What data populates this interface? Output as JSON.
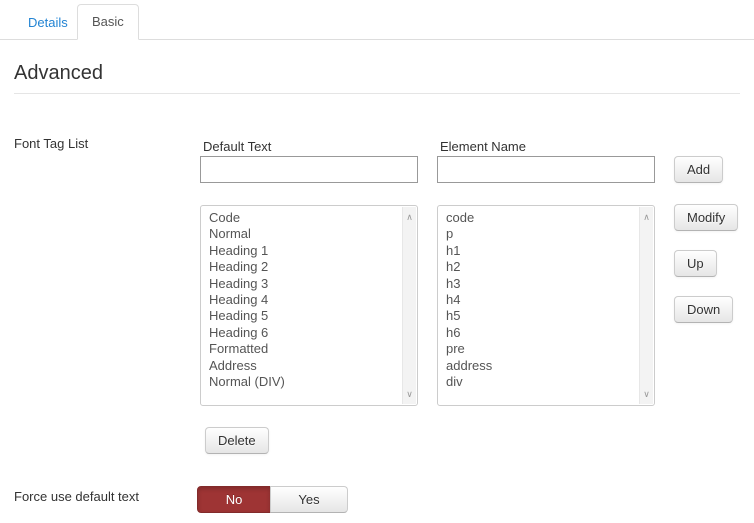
{
  "tabs": {
    "details": {
      "label": "Details",
      "active": false
    },
    "basic": {
      "label": "Basic",
      "active": true
    }
  },
  "heading": "Advanced",
  "form": {
    "font_tag_list": {
      "label": "Font Tag List",
      "default_text": {
        "label": "Default Text",
        "value": "",
        "placeholder": ""
      },
      "element_name": {
        "label": "Element Name",
        "value": "",
        "placeholder": ""
      },
      "default_text_options": [
        "Code",
        "Normal",
        "Heading 1",
        "Heading 2",
        "Heading 3",
        "Heading 4",
        "Heading 5",
        "Heading 6",
        "Formatted",
        "Address",
        "Normal (DIV)"
      ],
      "element_name_options": [
        "code",
        "p",
        "h1",
        "h2",
        "h3",
        "h4",
        "h5",
        "h6",
        "pre",
        "address",
        "div"
      ],
      "buttons": {
        "add": "Add",
        "modify": "Modify",
        "up": "Up",
        "down": "Down",
        "delete": "Delete"
      }
    },
    "force_use_default_text": {
      "label": "Force use default text",
      "selected": "No",
      "options": {
        "no": "No",
        "yes": "Yes"
      }
    }
  },
  "icons": {
    "scroll_up": "∧",
    "scroll_down": "∨"
  },
  "colors": {
    "tab_link_blue": "#2384d3",
    "tab_border": "#dddddd",
    "legend_border": "#e5e5e5",
    "active_no_red": "#9e3434",
    "input_border": "#999999",
    "listbox_border": "#cccccc"
  }
}
